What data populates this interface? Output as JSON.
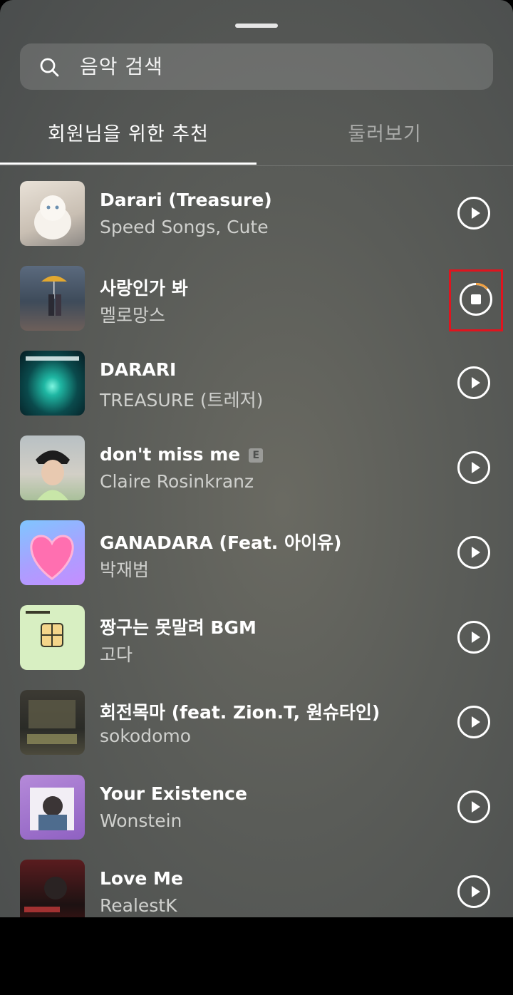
{
  "search": {
    "placeholder": "음악 검색"
  },
  "tabs": [
    {
      "label": "회원님을 위한 추천",
      "active": true
    },
    {
      "label": "둘러보기",
      "active": false
    }
  ],
  "songs": [
    {
      "title": "Darari (Treasure)",
      "artist": "Speed Songs, Cute",
      "state": "play"
    },
    {
      "title": "사랑인가 봐",
      "artist": "멜로망스",
      "state": "stop"
    },
    {
      "title": "DARARI",
      "artist": "TREASURE (트레저)",
      "state": "play"
    },
    {
      "title": "don't miss me",
      "artist": "Claire Rosinkranz",
      "state": "play",
      "explicit_badge": "E"
    },
    {
      "title": "GANADARA (Feat. 아이유)",
      "artist": "박재범",
      "state": "play"
    },
    {
      "title": "짱구는 못말려 BGM",
      "artist": "고다",
      "state": "play"
    },
    {
      "title": "회전목마 (feat. Zion.T, 원슈타인)",
      "artist": "sokodomo",
      "state": "play"
    },
    {
      "title": "Your Existence",
      "artist": "Wonstein",
      "state": "play"
    },
    {
      "title": "Love Me",
      "artist": "RealestK",
      "state": "play"
    }
  ],
  "colors": {
    "highlight_box": "#e0141e",
    "progress_arc": "#f0a040"
  }
}
